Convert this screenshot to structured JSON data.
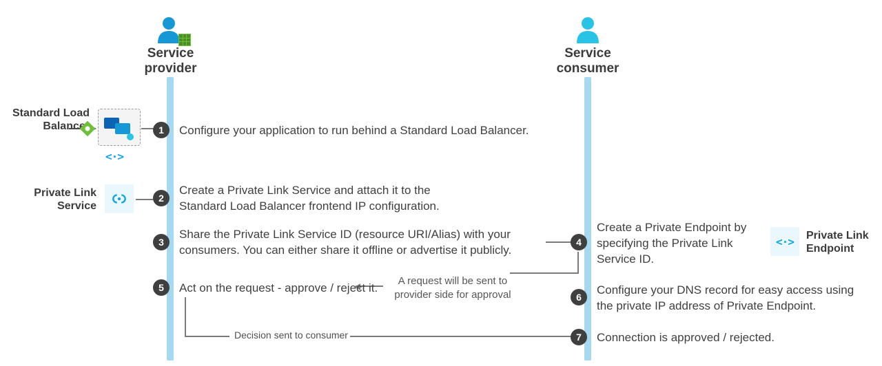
{
  "actors": {
    "provider": {
      "label_line1": "Service",
      "label_line2": "provider"
    },
    "consumer": {
      "label_line1": "Service",
      "label_line2": "consumer"
    }
  },
  "side": {
    "slb": {
      "label_line1": "Standard Load",
      "label_line2": "Balancer"
    },
    "pls": {
      "label_line1": "Private Link",
      "label_line2": "Service"
    },
    "ple": {
      "label_line1": "Private Link",
      "label_line2": "Endpoint"
    }
  },
  "steps": {
    "s1": {
      "num": "1",
      "text": "Configure your application to run behind a Standard Load Balancer."
    },
    "s2": {
      "num": "2",
      "text": "Create a Private Link Service and attach it to the Standard Load Balancer frontend IP configuration."
    },
    "s3": {
      "num": "3",
      "text": "Share the Private Link Service ID (resource URI/Alias) with your consumers. You can either share it offline or advertise it publicly."
    },
    "s4": {
      "num": "4",
      "text": "Create a Private Endpoint by specifying the Private Link Service ID."
    },
    "s5": {
      "num": "5",
      "text": "Act on the request - approve / reject it."
    },
    "s6": {
      "num": "6",
      "text": "Configure your DNS record for easy access using the private IP address of Private Endpoint."
    },
    "s7": {
      "num": "7",
      "text": "Connection is approved / rejected."
    }
  },
  "notes": {
    "request": {
      "line1": "A request will be sent to",
      "line2": "provider side for approval"
    },
    "decision": "Decision sent to consumer"
  },
  "colors": {
    "lifeline": "#a6d8f0",
    "step_circle": "#3f3f3f",
    "azure_icon": "#0ea5e9",
    "arrow": "#7a7a7a"
  }
}
